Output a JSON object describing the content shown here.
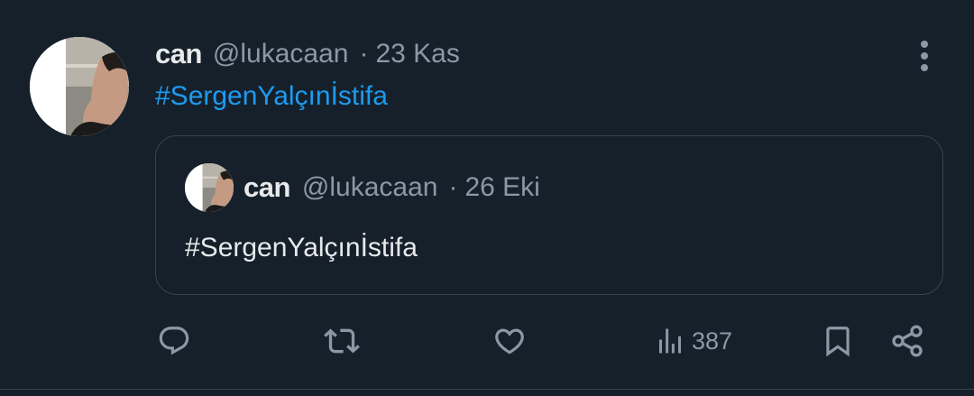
{
  "tweet": {
    "author_name": "can",
    "author_handle": "@lukacaan",
    "separator": "·",
    "date": "23 Kas",
    "text": "#SergenYalçınİstifa",
    "more_icon": "more-vertical-icon"
  },
  "quoted_tweet": {
    "author_name": "can",
    "author_handle": "@lukacaan",
    "separator": "·",
    "date": "26 Eki",
    "text": "#SergenYalçınİstifa"
  },
  "actions": {
    "reply_icon": "reply-icon",
    "retweet_icon": "retweet-icon",
    "like_icon": "heart-icon",
    "views_icon": "views-icon",
    "views_count": "387",
    "bookmark_icon": "bookmark-icon",
    "share_icon": "share-icon"
  },
  "colors": {
    "background": "#15202b",
    "primary_text": "#e7e9ea",
    "secondary_text": "#8b98a5",
    "link": "#1d9bf0",
    "border": "#38444d"
  }
}
